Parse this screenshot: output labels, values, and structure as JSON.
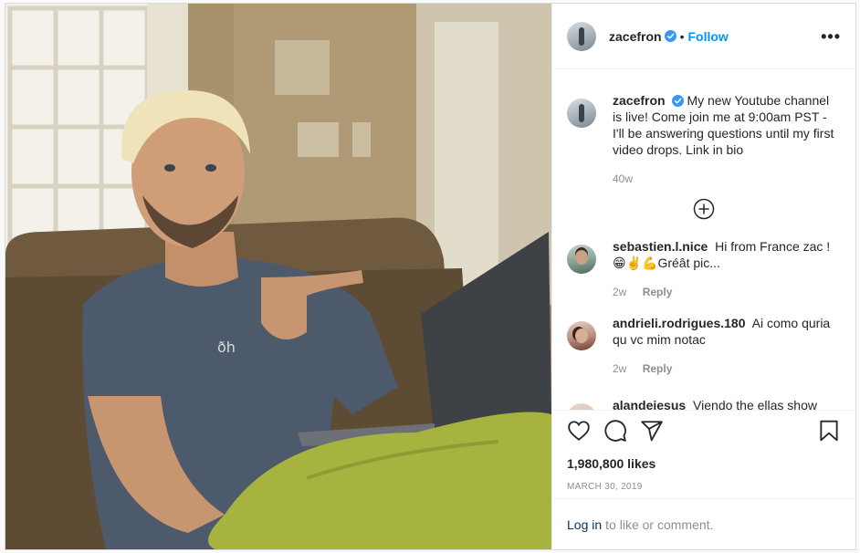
{
  "post": {
    "photo_alt": "",
    "header": {
      "username": "zacefron",
      "dot": "•",
      "follow_label": "Follow",
      "more_label": "•••"
    },
    "caption": {
      "username": "zacefron",
      "text": "My new Youtube channel is live! Come join me at 9:00am PST - I'll be answering questions until my first video drops. Link in bio",
      "age": "40w"
    },
    "comments": [
      {
        "username": "sebastien.l.nice",
        "text": "Hi from France zac ! 😁✌️💪Gréât pic...",
        "age": "2w",
        "reply_label": "Reply"
      },
      {
        "username": "andrieli.rodrigues.180",
        "text": "Ai como quria qu vc mim notac",
        "age": "2w",
        "reply_label": "Reply"
      },
      {
        "username": "alandejesus",
        "text": "Viendo the ellas show",
        "age": "",
        "reply_label": ""
      }
    ],
    "likes": "1,980,800 likes",
    "date": "MARCH 30, 2019",
    "login_prompt": {
      "link": "Log in",
      "text": "to like or comment."
    },
    "colors": {
      "accent": "#0095f6",
      "verified": "#3897f0",
      "link": "#00376b",
      "muted": "#8e8e8e"
    },
    "icons": [
      "verified-badge-icon",
      "more-options-icon",
      "load-more-comments-icon",
      "heart-icon",
      "comment-icon",
      "share-icon",
      "bookmark-icon"
    ]
  }
}
